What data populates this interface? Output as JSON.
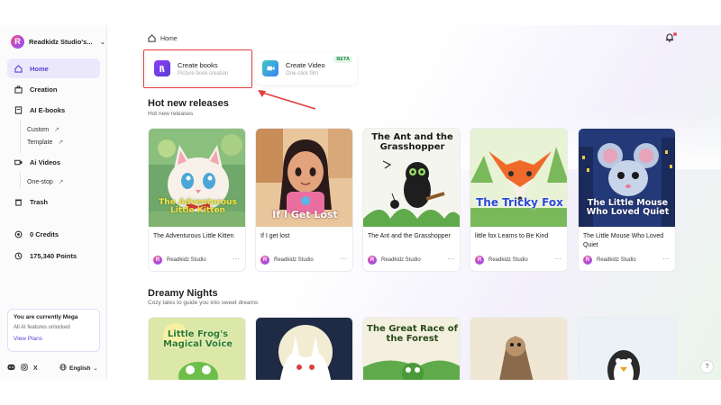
{
  "sidebar": {
    "brand": "Readkidz Studio's...",
    "nav": [
      {
        "label": "Home",
        "icon": "home-icon"
      },
      {
        "label": "Creation",
        "icon": "briefcase-icon"
      },
      {
        "label": "AI E-books",
        "icon": "ebook-icon"
      },
      {
        "label": "Ai Videos",
        "icon": "video-icon"
      },
      {
        "label": "Trash",
        "icon": "trash-icon"
      },
      {
        "label": "0 Credits",
        "icon": "credits-icon"
      },
      {
        "label": "175,340 Points",
        "icon": "points-icon"
      }
    ],
    "ebook_sub": [
      "Custom",
      "Template"
    ],
    "video_sub": [
      "One-stop"
    ],
    "plan": {
      "title": "You are currently Mega",
      "subtitle": "All AI features unlocked",
      "link": "View Plans"
    },
    "language": "English"
  },
  "header": {
    "breadcrumb": "Home"
  },
  "actions": {
    "create_books": {
      "title": "Create books",
      "subtitle": "Picture book creation"
    },
    "create_video": {
      "title": "Create Video",
      "subtitle": "One-click film",
      "badge": "BETA"
    }
  },
  "sections": [
    {
      "title": "Hot new releases",
      "subtitle": "Hot new releases",
      "books": [
        {
          "title": "The Adventurous Little Kitten",
          "cover_text": "The Adventurous Little Kitten",
          "author": "Readkidz Studio"
        },
        {
          "title": "If I get lost",
          "cover_text": "If I Get Lost",
          "author": "Readkidz Studio"
        },
        {
          "title": "The Ant and the Grasshopper",
          "cover_text": "The Ant and the Grasshopper",
          "author": "Readkidz Studio"
        },
        {
          "title": "little fox Learns to Be Kind",
          "cover_text": "The Tricky Fox",
          "author": "Readkidz Studio"
        },
        {
          "title": "The Little Mouse Who Loved Quiet",
          "cover_text": "The Little Mouse Who Loved Quiet",
          "author": "Readkidz Studio"
        }
      ]
    },
    {
      "title": "Dreamy Nights",
      "subtitle": "Cozy tales to guide you into sweet dreams",
      "books": [
        {
          "cover_text": "Little Frog's Magical Voice"
        },
        {
          "cover_text": ""
        },
        {
          "cover_text": "The Great Race of the Forest"
        },
        {
          "cover_text": ""
        },
        {
          "cover_text": ""
        }
      ]
    }
  ],
  "help": "?"
}
